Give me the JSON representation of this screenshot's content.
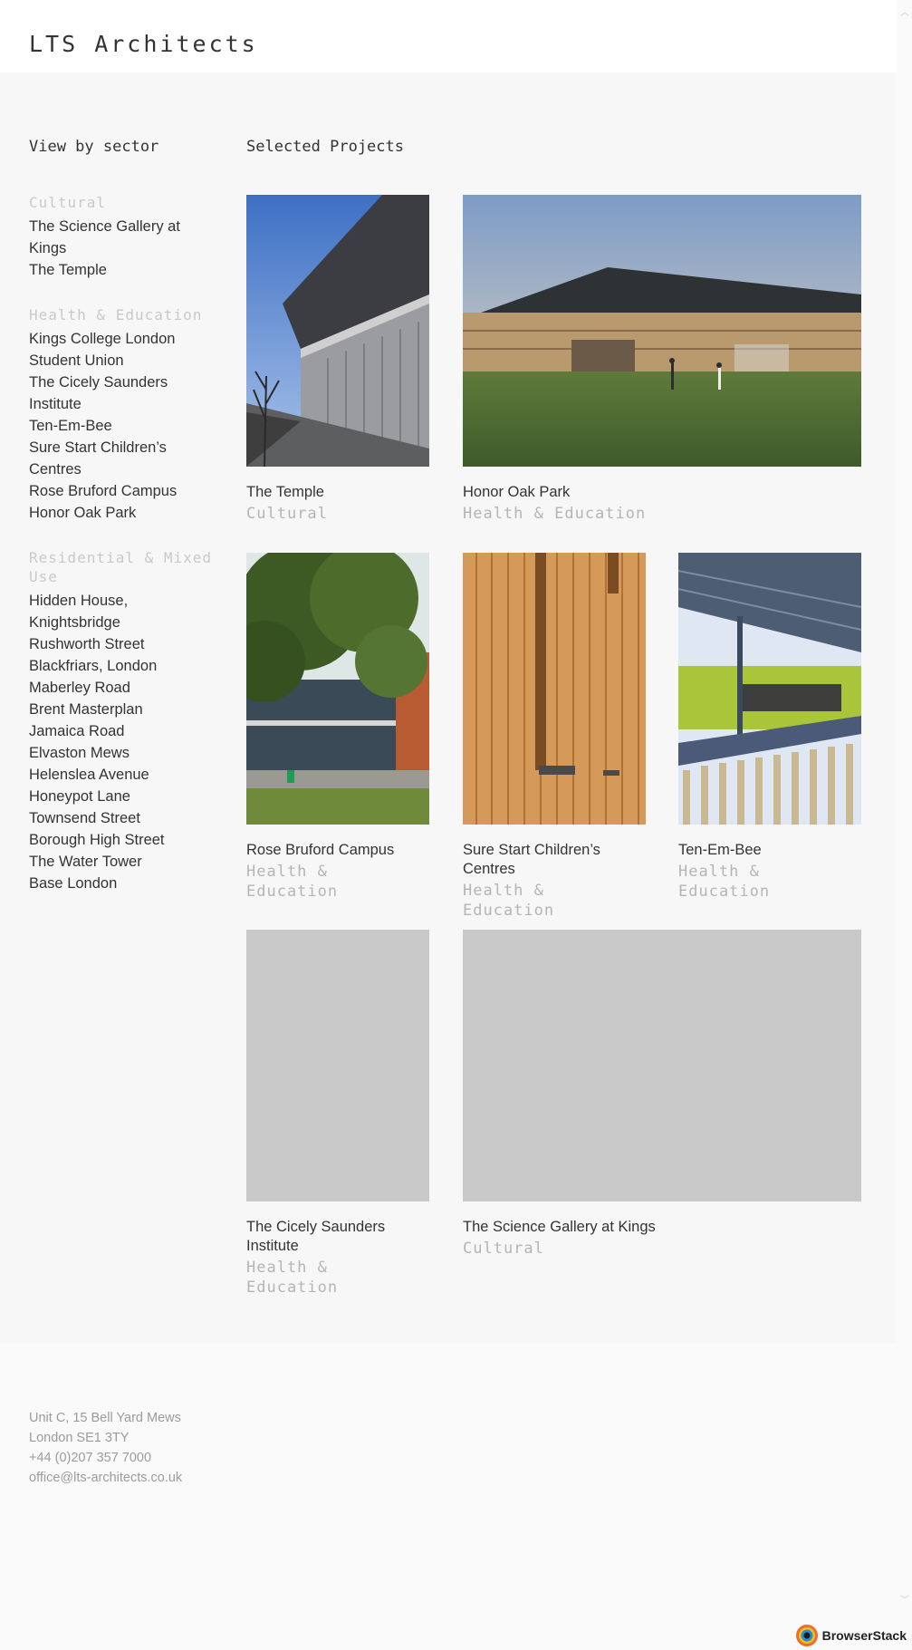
{
  "header": {
    "logo": "LTS Architects"
  },
  "sidebar": {
    "heading": "View by sector",
    "sectors": [
      {
        "title": "Cultural",
        "items": [
          "The Science Gallery at Kings",
          "The Temple"
        ]
      },
      {
        "title": "Health & Education",
        "items": [
          "Kings College London Student Union",
          "The Cicely Saunders Institute",
          "Ten-Em-Bee",
          "Sure Start Children’s Centres",
          "Rose Bruford Campus",
          "Honor Oak Park"
        ]
      },
      {
        "title": "Residential & Mixed Use",
        "items": [
          "Hidden House, Knightsbridge",
          "Rushworth Street",
          "Blackfriars, London",
          "Maberley Road",
          "Brent Masterplan",
          "Jamaica Road",
          "Elvaston Mews",
          "Helenslea Avenue",
          "Honeypot Lane",
          "Townsend Street",
          "Borough High Street",
          "The Water Tower",
          "Base London"
        ]
      }
    ]
  },
  "main": {
    "title": "Selected Projects",
    "projects": [
      {
        "name": "The Temple",
        "category": "Cultural"
      },
      {
        "name": "Honor Oak Park",
        "category": "Health & Education"
      },
      {
        "name": "Rose Bruford Campus",
        "category": "Health & Education"
      },
      {
        "name": "Sure Start Children’s Centres",
        "category": "Health & Education"
      },
      {
        "name": "Ten-Em-Bee",
        "category": "Health & Education"
      },
      {
        "name": "The Cicely Saunders Institute",
        "category": "Health & Education"
      },
      {
        "name": "The Science Gallery at Kings",
        "category": "Cultural"
      }
    ]
  },
  "footer": {
    "address1": "Unit C, 15 Bell Yard Mews",
    "address2": "London SE1 3TY",
    "phone": "+44 (0)207 357 7000",
    "email": "office@lts-architects.co.uk"
  },
  "badge": {
    "label": "BrowserStack"
  }
}
